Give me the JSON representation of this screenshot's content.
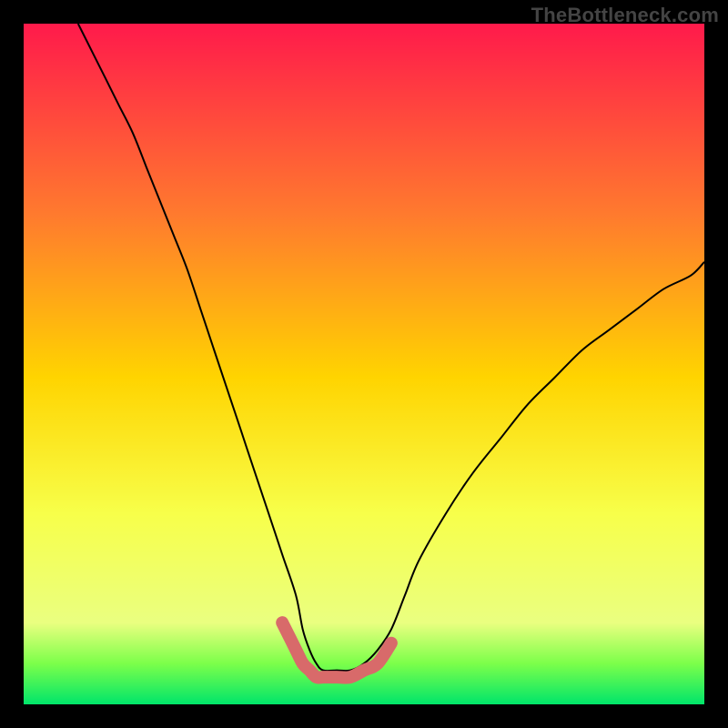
{
  "watermark": "TheBottleneck.com",
  "chart_data": {
    "type": "line",
    "title": "",
    "xlabel": "",
    "ylabel": "",
    "xlim": [
      0,
      100
    ],
    "ylim": [
      0,
      100
    ],
    "background_gradient": {
      "top": "#ff1a4b",
      "mid_upper": "#ff7a2e",
      "mid": "#ffd400",
      "mid_lower": "#f7ff4a",
      "green_band": "#7cff4a",
      "bottom": "#00e56a"
    },
    "series": [
      {
        "name": "bottleneck-curve",
        "style": "thin-black",
        "x": [
          8,
          10,
          12,
          14,
          16,
          18,
          20,
          22,
          24,
          26,
          28,
          30,
          32,
          34,
          36,
          38,
          40,
          41,
          42,
          43,
          44,
          46,
          48,
          50,
          52,
          54,
          56,
          58,
          62,
          66,
          70,
          74,
          78,
          82,
          86,
          90,
          94,
          98,
          100
        ],
        "y": [
          100,
          96,
          92,
          88,
          84,
          79,
          74,
          69,
          64,
          58,
          52,
          46,
          40,
          34,
          28,
          22,
          16,
          11,
          8,
          6,
          5,
          5,
          5,
          6,
          8,
          11,
          16,
          21,
          28,
          34,
          39,
          44,
          48,
          52,
          55,
          58,
          61,
          63,
          65
        ]
      },
      {
        "name": "optimal-flat-highlight",
        "style": "thick-salmon",
        "x": [
          38,
          40,
          41,
          42,
          43,
          44,
          46,
          48,
          50,
          52,
          54
        ],
        "y": [
          12,
          8,
          6,
          5,
          4,
          4,
          4,
          4,
          5,
          6,
          9
        ]
      }
    ],
    "annotations": []
  }
}
